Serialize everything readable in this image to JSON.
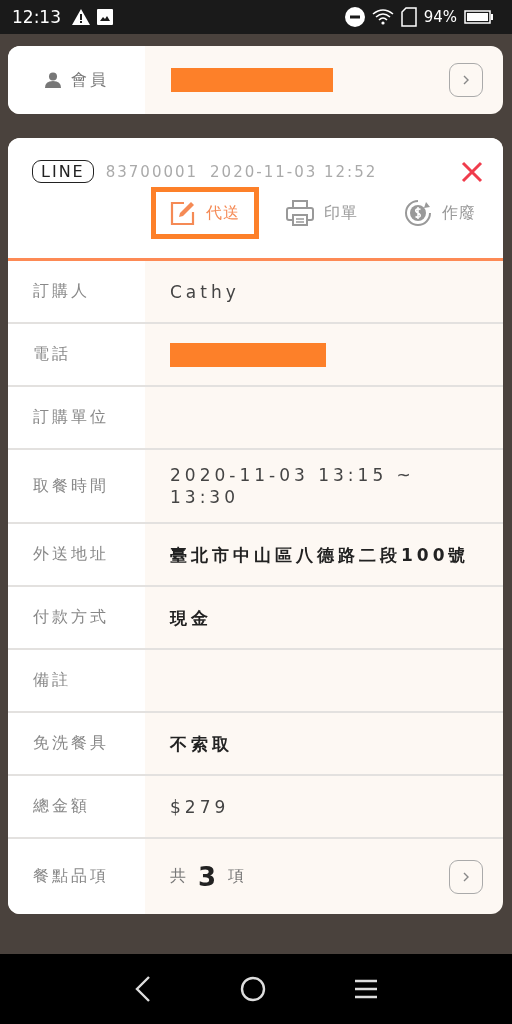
{
  "status_bar": {
    "time": "12:13",
    "battery": "94%"
  },
  "member": {
    "label": "會員",
    "redacted": true
  },
  "order": {
    "source": "LINE",
    "number": "83700001",
    "datetime": "2020-11-03 12:52",
    "actions": [
      {
        "kind": "edit",
        "label": "代送",
        "highlighted": true
      },
      {
        "kind": "print",
        "label": "印單",
        "highlighted": false
      },
      {
        "kind": "void",
        "label": "作廢",
        "highlighted": false
      }
    ],
    "rows": [
      {
        "kind": "plain",
        "label": "訂購人",
        "value": "Cathy"
      },
      {
        "kind": "redacted",
        "label": "電話"
      },
      {
        "kind": "empty",
        "label": "訂購單位"
      },
      {
        "kind": "plain",
        "label": "取餐時間",
        "value": "2020-11-03 13:15 ~ 13:30"
      },
      {
        "kind": "strong",
        "label": "外送地址",
        "value": "臺北市中山區八德路二段100號"
      },
      {
        "kind": "strong",
        "label": "付款方式",
        "value": "現金"
      },
      {
        "kind": "empty",
        "label": "備註"
      },
      {
        "kind": "strong",
        "label": "免洗餐具",
        "value": "不索取"
      },
      {
        "kind": "plain",
        "label": "總金額",
        "value": "$279"
      },
      {
        "kind": "count",
        "label": "餐點品項",
        "prefix": "共",
        "count": "3",
        "suffix": "項"
      }
    ]
  }
}
